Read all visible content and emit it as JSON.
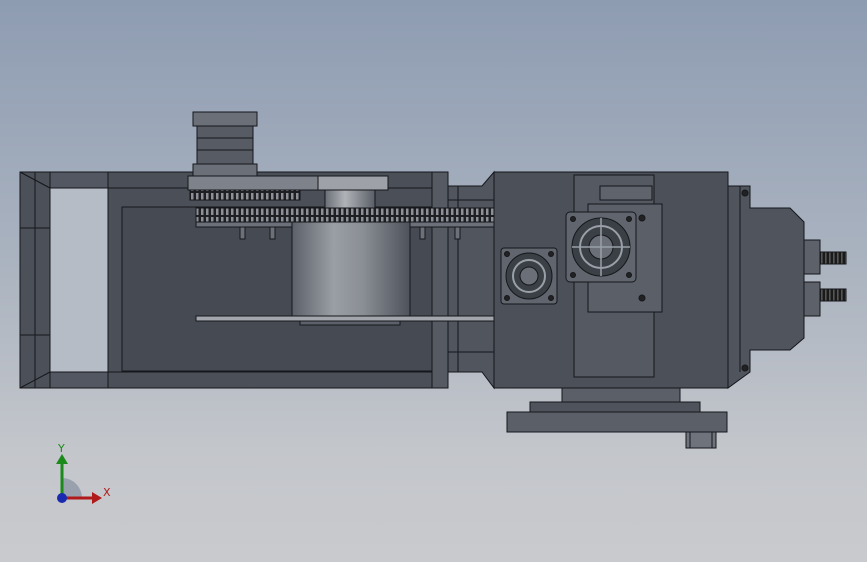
{
  "viewport": {
    "background_top": "#8e9cb2",
    "background_bottom": "#c9cacd"
  },
  "model": {
    "name": "",
    "body_color": "#4a4f58",
    "edge_color": "#15171b",
    "highlight_color": "#8a8f98"
  },
  "triad": {
    "x_label": "X",
    "y_label": "Y",
    "x_color": "#b01a1a",
    "y_color": "#1a8a1a",
    "z_color": "#1a2ab0"
  }
}
